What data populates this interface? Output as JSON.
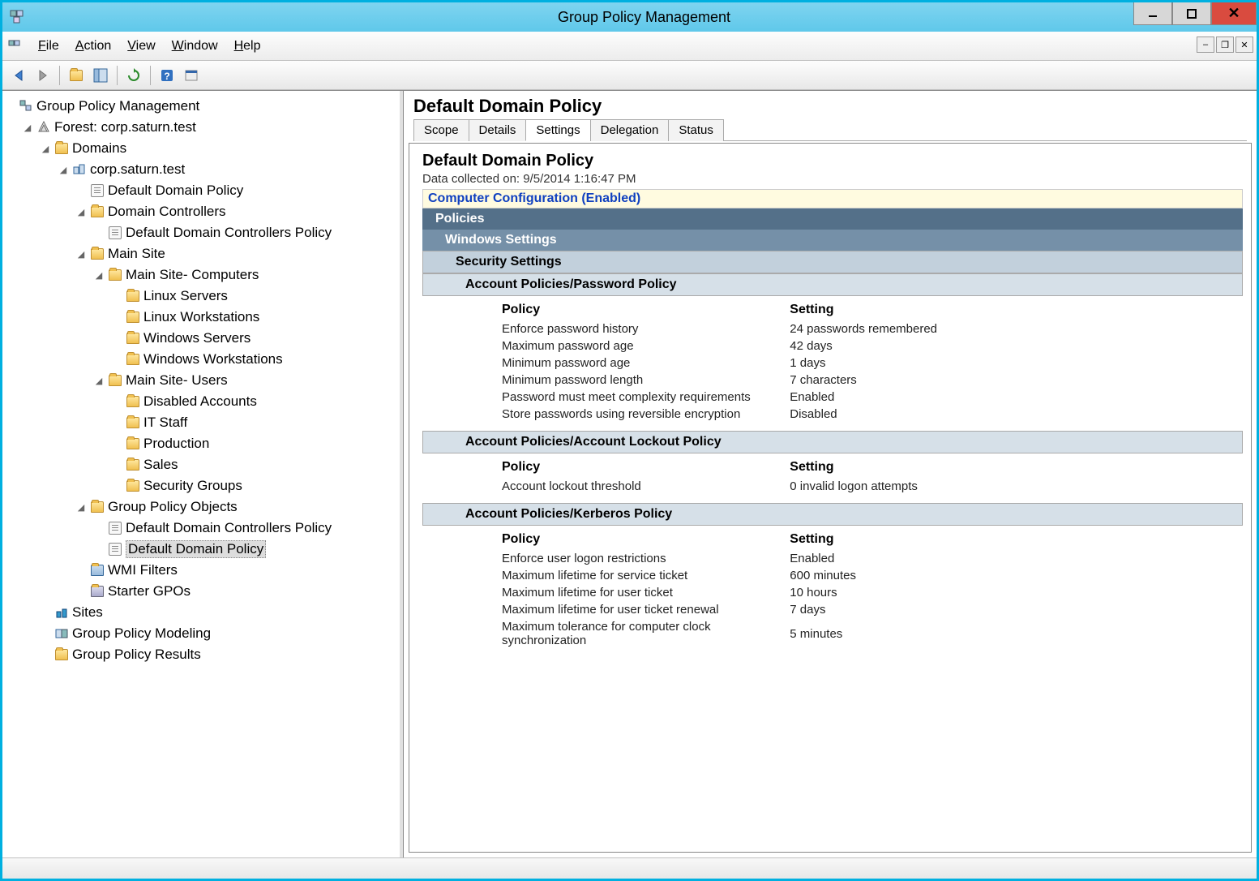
{
  "window": {
    "title": "Group Policy Management"
  },
  "menu": {
    "file": "File",
    "action": "Action",
    "view": "View",
    "window": "Window",
    "help": "Help"
  },
  "tree": {
    "root": "Group Policy Management",
    "forest": "Forest: corp.saturn.test",
    "domains": "Domains",
    "domain": "corp.saturn.test",
    "ddp": "Default Domain Policy",
    "dc": "Domain Controllers",
    "ddcp": "Default Domain Controllers Policy",
    "mainsite": "Main Site",
    "mscomputers": "Main Site- Computers",
    "linuxservers": "Linux Servers",
    "linuxws": "Linux Workstations",
    "winservers": "Windows Servers",
    "winws": "Windows Workstations",
    "msusers": "Main Site- Users",
    "disabled": "Disabled Accounts",
    "itstaff": "IT Staff",
    "production": "Production",
    "sales": "Sales",
    "secgroups": "Security Groups",
    "gpo": "Group Policy Objects",
    "gpo_ddcp": "Default Domain Controllers Policy",
    "gpo_ddp": "Default Domain Policy",
    "wmi": "WMI Filters",
    "starter": "Starter GPOs",
    "sites": "Sites",
    "modeling": "Group Policy Modeling",
    "results": "Group Policy Results"
  },
  "detail": {
    "title": "Default Domain Policy",
    "tabs": {
      "scope": "Scope",
      "details": "Details",
      "settings": "Settings",
      "delegation": "Delegation",
      "status": "Status"
    },
    "gpoTitle": "Default Domain Policy",
    "collected": "Data collected on: 9/5/2014 1:16:47 PM",
    "compConfig": "Computer Configuration (Enabled)",
    "sections": {
      "policies": "Policies",
      "winset": "Windows Settings",
      "secset": "Security Settings",
      "pwdpol": "Account Policies/Password Policy",
      "lockpol": "Account Policies/Account Lockout Policy",
      "kerbpol": "Account Policies/Kerberos Policy"
    },
    "headers": {
      "policy": "Policy",
      "setting": "Setting"
    },
    "pwd": [
      {
        "p": "Enforce password history",
        "s": "24 passwords remembered"
      },
      {
        "p": "Maximum password age",
        "s": "42 days"
      },
      {
        "p": "Minimum password age",
        "s": "1 days"
      },
      {
        "p": "Minimum password length",
        "s": "7 characters"
      },
      {
        "p": "Password must meet complexity requirements",
        "s": "Enabled"
      },
      {
        "p": "Store passwords using reversible encryption",
        "s": "Disabled"
      }
    ],
    "lock": [
      {
        "p": "Account lockout threshold",
        "s": "0 invalid logon attempts"
      }
    ],
    "kerb": [
      {
        "p": "Enforce user logon restrictions",
        "s": "Enabled"
      },
      {
        "p": "Maximum lifetime for service ticket",
        "s": "600 minutes"
      },
      {
        "p": "Maximum lifetime for user ticket",
        "s": "10 hours"
      },
      {
        "p": "Maximum lifetime for user ticket renewal",
        "s": "7 days"
      },
      {
        "p": "Maximum tolerance for computer clock synchronization",
        "s": "5 minutes"
      }
    ]
  }
}
